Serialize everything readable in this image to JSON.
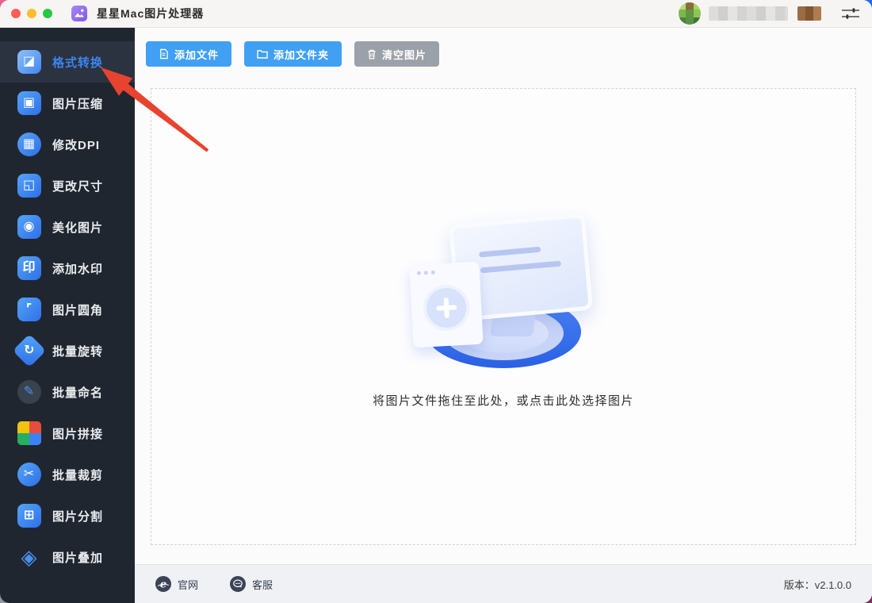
{
  "titlebar": {
    "app_title": "星星Mac图片处理器"
  },
  "user": {
    "avatar": "green-pixelated-avatar",
    "name_censored": true
  },
  "sidebar": {
    "items": [
      {
        "name": "format-convert",
        "label": "格式转换",
        "icon": "format-convert-icon",
        "glyph": "◪",
        "shape": "square",
        "selected": true
      },
      {
        "name": "image-compress",
        "label": "图片压缩",
        "icon": "image-compress-icon",
        "glyph": "▣",
        "shape": "square",
        "selected": false
      },
      {
        "name": "modify-dpi",
        "label": "修改DPI",
        "icon": "modify-dpi-icon",
        "glyph": "▦",
        "shape": "circle",
        "selected": false
      },
      {
        "name": "resize",
        "label": "更改尺寸",
        "icon": "resize-icon",
        "glyph": "◱",
        "shape": "square",
        "selected": false
      },
      {
        "name": "beautify",
        "label": "美化图片",
        "icon": "beautify-icon",
        "glyph": "◉",
        "shape": "square",
        "selected": false
      },
      {
        "name": "watermark",
        "label": "添加水印",
        "icon": "watermark-icon",
        "glyph": "印",
        "shape": "square",
        "selected": false
      },
      {
        "name": "rounded-corner",
        "label": "图片圆角",
        "icon": "rounded-corner-icon",
        "glyph": "⌜",
        "shape": "square",
        "selected": false
      },
      {
        "name": "batch-rotate",
        "label": "批量旋转",
        "icon": "batch-rotate-icon",
        "glyph": "↻",
        "shape": "diamond",
        "selected": false
      },
      {
        "name": "batch-rename",
        "label": "批量命名",
        "icon": "batch-rename-icon",
        "glyph": "✎",
        "shape": "circle-dark",
        "selected": false
      },
      {
        "name": "image-stitch",
        "label": "图片拼接",
        "icon": "image-stitch-icon",
        "glyph": "",
        "shape": "puzzle",
        "selected": false
      },
      {
        "name": "batch-crop",
        "label": "批量裁剪",
        "icon": "batch-crop-icon",
        "glyph": "✂",
        "shape": "circle",
        "selected": false
      },
      {
        "name": "image-split",
        "label": "图片分割",
        "icon": "image-split-icon",
        "glyph": "⊞",
        "shape": "square",
        "selected": false
      },
      {
        "name": "image-overlay",
        "label": "图片叠加",
        "icon": "image-overlay-icon",
        "glyph": "◈",
        "shape": "plain",
        "selected": false
      }
    ]
  },
  "toolbar": {
    "buttons": [
      {
        "name": "add-file-button",
        "label": "添加文件",
        "icon": "file-icon",
        "style": "primary"
      },
      {
        "name": "add-folder-button",
        "label": "添加文件夹",
        "icon": "folder-icon",
        "style": "primary"
      },
      {
        "name": "clear-images-button",
        "label": "清空图片",
        "icon": "trash-icon",
        "style": "secondary"
      }
    ]
  },
  "dropzone": {
    "hint": "将图片文件拖住至此处，或点击此处选择图片"
  },
  "footer": {
    "links": [
      {
        "name": "official-site-link",
        "label": "官网",
        "icon": "globe-icon"
      },
      {
        "name": "customer-service-link",
        "label": "客服",
        "icon": "chat-icon"
      }
    ],
    "version": "版本：v2.1.0.0"
  },
  "annotation": {
    "type": "red-arrow",
    "points_to": "格式转换",
    "color": "#e8432e"
  },
  "colors": {
    "accent_blue": "#41a0f4",
    "sidebar_bg": "#20262f",
    "sidebar_selected_bg": "#2b3240",
    "sidebar_selected_text": "#3d85ee",
    "secondary_gray": "#9ba1a9",
    "traffic_close": "#ff5f57",
    "traffic_min": "#febc2e",
    "traffic_max": "#28c840"
  }
}
